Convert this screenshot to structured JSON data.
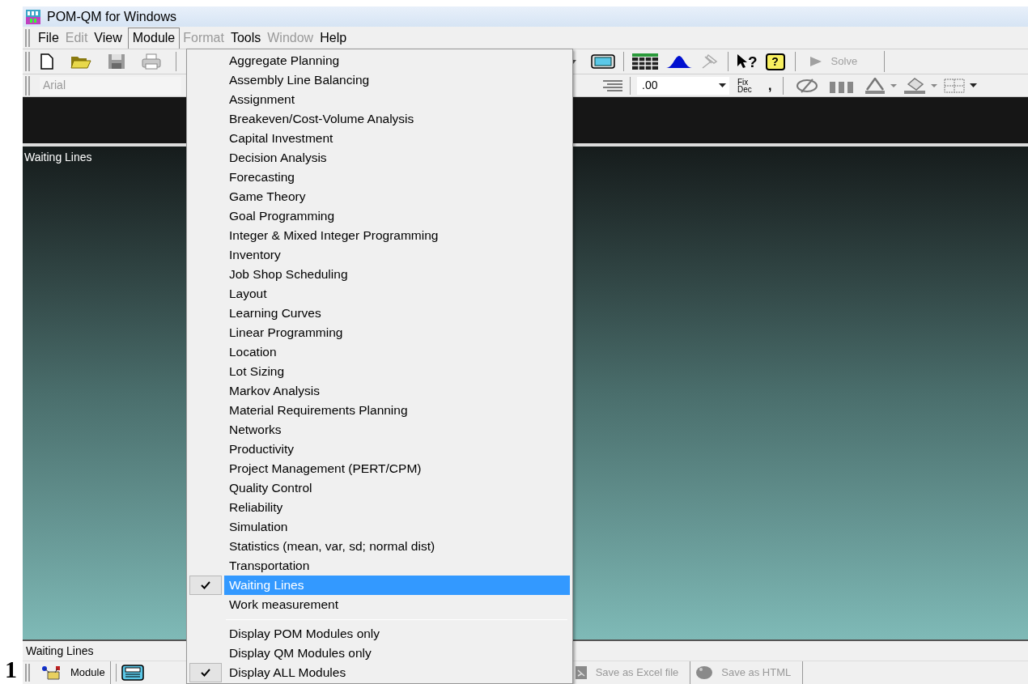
{
  "window": {
    "title": "POM-QM for Windows"
  },
  "menu_bar": [
    {
      "label": "File",
      "disabled": false,
      "selected": false
    },
    {
      "label": "Edit",
      "disabled": true,
      "selected": false
    },
    {
      "label": "View",
      "disabled": false,
      "selected": false
    },
    {
      "label": "Module",
      "disabled": false,
      "selected": true
    },
    {
      "label": "Format",
      "disabled": true,
      "selected": false
    },
    {
      "label": "Tools",
      "disabled": false,
      "selected": false
    },
    {
      "label": "Window",
      "disabled": true,
      "selected": false
    },
    {
      "label": "Help",
      "disabled": false,
      "selected": false
    }
  ],
  "toolbar": {
    "help_marks": [
      "?",
      "?"
    ],
    "font_field": {
      "value": "Arial",
      "disabled": true
    },
    "format_field": {
      "value": ".00"
    },
    "fix_dec": "Fix Dec",
    "comma": ",",
    "solve_button": {
      "label": "Solve",
      "disabled": true
    }
  },
  "main_panel": {
    "title": "Waiting Lines"
  },
  "module_menu": {
    "items": [
      {
        "label": "Aggregate Planning",
        "checked": false,
        "selected": false
      },
      {
        "label": "Assembly Line Balancing",
        "checked": false,
        "selected": false
      },
      {
        "label": "Assignment",
        "checked": false,
        "selected": false
      },
      {
        "label": "Breakeven/Cost-Volume Analysis",
        "checked": false,
        "selected": false
      },
      {
        "label": "Capital Investment",
        "checked": false,
        "selected": false
      },
      {
        "label": "Decision Analysis",
        "checked": false,
        "selected": false
      },
      {
        "label": "Forecasting",
        "checked": false,
        "selected": false
      },
      {
        "label": "Game Theory",
        "checked": false,
        "selected": false
      },
      {
        "label": "Goal Programming",
        "checked": false,
        "selected": false
      },
      {
        "label": "Integer & Mixed Integer Programming",
        "checked": false,
        "selected": false
      },
      {
        "label": "Inventory",
        "checked": false,
        "selected": false
      },
      {
        "label": "Job Shop Scheduling",
        "checked": false,
        "selected": false
      },
      {
        "label": "Layout",
        "checked": false,
        "selected": false
      },
      {
        "label": "Learning Curves",
        "checked": false,
        "selected": false
      },
      {
        "label": "Linear Programming",
        "checked": false,
        "selected": false
      },
      {
        "label": "Location",
        "checked": false,
        "selected": false
      },
      {
        "label": "Lot Sizing",
        "checked": false,
        "selected": false
      },
      {
        "label": "Markov Analysis",
        "checked": false,
        "selected": false
      },
      {
        "label": "Material Requirements Planning",
        "checked": false,
        "selected": false
      },
      {
        "label": "Networks",
        "checked": false,
        "selected": false
      },
      {
        "label": "Productivity",
        "checked": false,
        "selected": false
      },
      {
        "label": "Project Management (PERT/CPM)",
        "checked": false,
        "selected": false
      },
      {
        "label": "Quality Control",
        "checked": false,
        "selected": false
      },
      {
        "label": "Reliability",
        "checked": false,
        "selected": false
      },
      {
        "label": "Simulation",
        "checked": false,
        "selected": false
      },
      {
        "label": "Statistics (mean, var, sd; normal dist)",
        "checked": false,
        "selected": false
      },
      {
        "label": "Transportation",
        "checked": false,
        "selected": false
      },
      {
        "label": "Waiting Lines",
        "checked": true,
        "selected": true
      },
      {
        "label": "Work measurement",
        "checked": false,
        "selected": false
      }
    ],
    "display_options": [
      {
        "label": "Display POM Modules only",
        "checked": false
      },
      {
        "label": "Display QM Modules only",
        "checked": false
      },
      {
        "label": "Display ALL Modules",
        "checked": true
      }
    ]
  },
  "status_bar": {
    "text": "Waiting Lines"
  },
  "bottom_toolbar": [
    {
      "label": "Module",
      "disabled": false,
      "kind": "module"
    },
    {
      "label": "Save as Excel file",
      "disabled": true,
      "kind": "excel"
    },
    {
      "label": "Save as HTML",
      "disabled": true,
      "kind": "html"
    }
  ],
  "page_number": "1"
}
